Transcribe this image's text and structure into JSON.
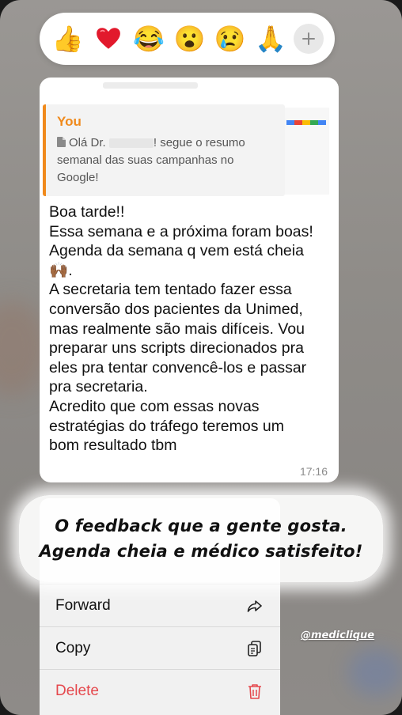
{
  "reactions": {
    "emojis": [
      "👍",
      "❤️",
      "😂",
      "😮",
      "😢",
      "🙏"
    ],
    "more_icon": "plus-icon"
  },
  "message": {
    "quote": {
      "author": "You",
      "text_before": "Olá Dr. ",
      "text_after": "! segue o resumo semanal das suas campanhas no Google!",
      "icon": "document-icon"
    },
    "body": "Boa tarde!!\nEssa semana e a próxima foram boas!\nAgenda da semana q vem está cheia\n🙌🏾.\nA secretaria tem tentado fazer essa\nconversão dos pacientes da Unimed,\nmas realmente são mais difíceis. Vou\npreparar uns scripts direcionados pra\neles pra tentar convencê-los e passar\npra secretaria.\nAcredito que com essas novas\nestratégias do tráfego teremos um\nbom resultado tbm",
    "time": "17:16"
  },
  "menu": {
    "items": [
      {
        "label": "Forward",
        "icon": "forward-icon"
      },
      {
        "label": "Copy",
        "icon": "copy-icon"
      },
      {
        "label": "Delete",
        "icon": "trash-icon",
        "color": "#e5484d"
      }
    ]
  },
  "overlay": {
    "caption_line1": "O feedback que a gente gosta.",
    "caption_line2": "Agenda cheia e médico satisfeito!",
    "handle": "@mediclique"
  },
  "colors": {
    "accent_orange": "#f08a1c",
    "delete_red": "#e5484d"
  }
}
